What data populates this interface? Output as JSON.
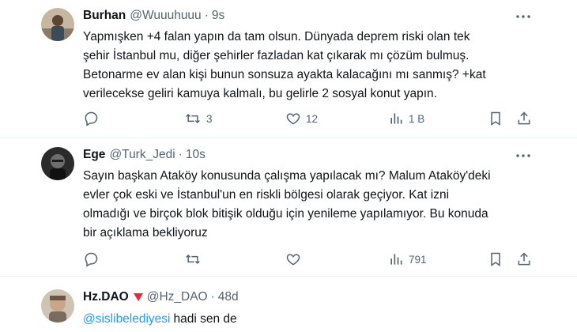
{
  "tweets": [
    {
      "name": "Burhan",
      "handle": "@Wuuuhuuu",
      "dot": "·",
      "time": "9s",
      "lines": [
        "Yapmışken +4 falan yapın da tam olsun. Dünyada deprem riski olan tek",
        "şehir İstanbul mu, diğer şehirler fazladan kat çıkarak mı çözüm bulmuş.",
        "Betonarme ev alan kişi bunun sonsuza ayakta kalacağını mı sanmış? +kat",
        "verilecekse geliri kamuya kalmalı, bu gelirle 2 sosyal konut yapın."
      ],
      "actions": {
        "replies": "",
        "retweets": "3",
        "likes": "12",
        "views": "1 B"
      }
    },
    {
      "name": "Ege",
      "handle": "@Turk_Jedi",
      "dot": "·",
      "time": "10s",
      "lines": [
        "Sayın başkan Ataköy konusunda çalışma yapılacak mı? Malum Ataköy'deki",
        "evler çok eski ve İstanbul'un en riskli bölgesi olarak geçiyor. Kat izni",
        "olmadığı ve birçok blok bitişik olduğu için yenileme yapılamıyor. Bu konuda",
        "bir açıklama bekliyoruz"
      ],
      "actions": {
        "replies": "",
        "retweets": "",
        "likes": "",
        "views": "791"
      }
    },
    {
      "name": "Hz.DAO",
      "handle": "@Hz_DAO",
      "dot": "·",
      "time": "48d",
      "mention": "@sislibelediyesi",
      "text": "hadi sen de"
    }
  ],
  "colors": {
    "text": "#0f1419",
    "secondary": "#536471",
    "accent": "#1d9bf0",
    "badge": "#f4212e",
    "divider": "#eff3f4"
  },
  "icons": [
    "reply-icon",
    "retweet-icon",
    "like-icon",
    "views-icon",
    "bookmark-icon",
    "share-icon",
    "more-icon",
    "triangle-badge-icon"
  ]
}
